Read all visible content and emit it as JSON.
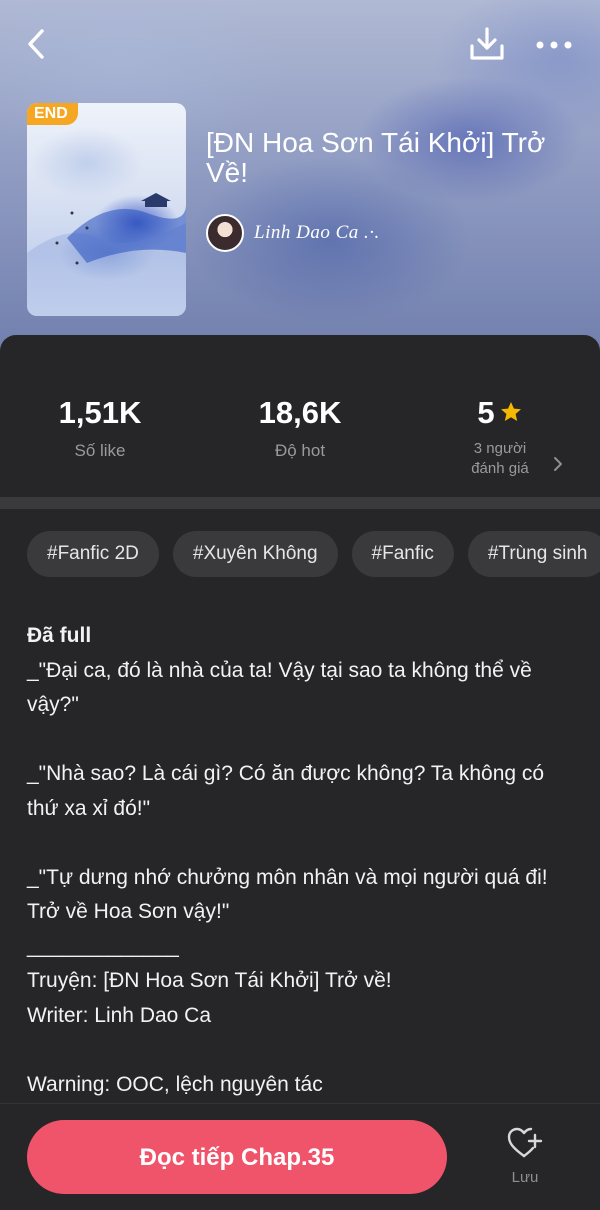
{
  "header": {
    "back_icon": "chevron-left-icon",
    "download_icon": "download-icon",
    "more_icon": "more-icon"
  },
  "book": {
    "badge": "END",
    "title": "[ĐN Hoa Sơn Tái Khởi] Trở Về!",
    "author": "Linh Dao Ca .·."
  },
  "stats": {
    "likes": {
      "value": "1,51K",
      "label": "Số like"
    },
    "hot": {
      "value": "18,6K",
      "label": "Độ hot"
    },
    "rating": {
      "value": "5",
      "label_line1": "3 người",
      "label_line2": "đánh giá"
    }
  },
  "tags": [
    "#Fanfic 2D",
    "#Xuyên Không",
    "#Fanfic",
    "#Trùng sinh"
  ],
  "description": {
    "status": "Đã full",
    "lines": [
      "_\"Đại ca, đó là nhà của ta! Vậy tại sao ta không thể về vậy?\"",
      "",
      "_\"Nhà sao? Là cái gì? Có ăn được không? Ta không có thứ xa xỉ đó!\"",
      "",
      "_\"Tự dưng nhớ chưởng môn nhân và mọi người quá đi! Trở về Hoa Sơn vậy!\"",
      "_____________",
      "Truyện: [ĐN Hoa Sơn Tái Khởi] Trở về!",
      "Writer: Linh Dao Ca",
      "",
      "Warning: OOC, lệch nguyên tác"
    ]
  },
  "bottom": {
    "read_label": "Đọc tiếp Chap.35",
    "save_label": "Lưu"
  },
  "colors": {
    "accent": "#f0546a",
    "badge": "#f5a623",
    "star": "#f5b800",
    "panel": "#262628"
  }
}
